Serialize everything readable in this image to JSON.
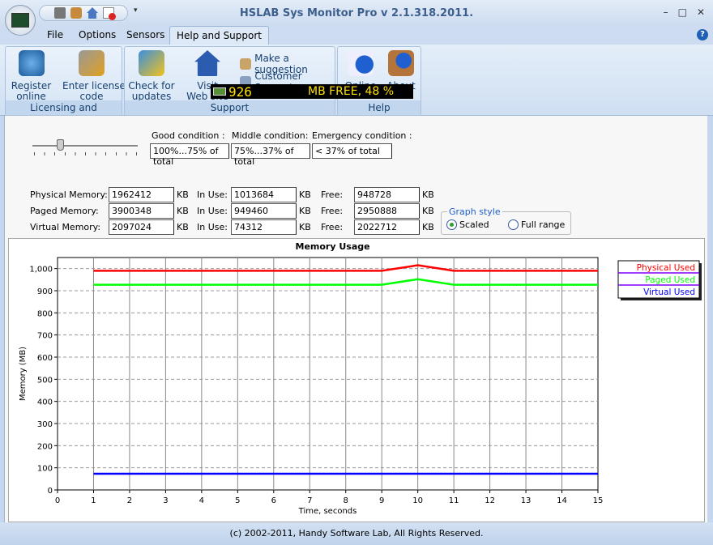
{
  "window": {
    "title": "HSLAB Sys Monitor Pro v 2.1.318.2011.",
    "controls": [
      "–",
      "□",
      "✕"
    ]
  },
  "menu_tabs": [
    {
      "label": "File"
    },
    {
      "label": "Options"
    },
    {
      "label": "Sensors"
    },
    {
      "label": "Help and Support",
      "active": true
    }
  ],
  "ribbon": {
    "groups": [
      {
        "label": "Licensing and Activation",
        "buttons": [
          {
            "label": "Register\nonline",
            "icon": "globe-checklist-icon"
          },
          {
            "label": "Enter license\ncode",
            "icon": "keys-icon"
          }
        ]
      },
      {
        "label": "Support",
        "buttons": [
          {
            "label": "Check for\nupdates",
            "icon": "refresh-arrows-icon"
          },
          {
            "label": "Visit\nWeb site",
            "icon": "house-icon"
          }
        ],
        "small_buttons": [
          {
            "label": "Make a suggestion",
            "icon": "quill-icon"
          },
          {
            "label": "Customer Support",
            "icon": "support-person-icon"
          }
        ]
      },
      {
        "label": "Help",
        "buttons": [
          {
            "label": "Online",
            "icon": "help-document-icon"
          },
          {
            "label": "About",
            "icon": "about-hand-icon"
          }
        ]
      }
    ]
  },
  "overlay": {
    "value": "926",
    "text": "MB FREE,  48 %",
    "color": "#ffe000"
  },
  "conditions": {
    "good": {
      "label": "Good condition :",
      "value": "100%...75% of total"
    },
    "middle": {
      "label": "Middle condition:",
      "value": "75%...37% of total"
    },
    "emergency": {
      "label": "Emergency condition :",
      "value": "< 37% of total"
    }
  },
  "memory": {
    "unit": "KB",
    "in_use_label": "In Use:",
    "free_label": "Free:",
    "rows": [
      {
        "label": "Physical Memory:",
        "total": "1962412",
        "in_use": "1013684",
        "free": "948728"
      },
      {
        "label": "Paged Memory:",
        "total": "3900348",
        "in_use": "949460",
        "free": "2950888"
      },
      {
        "label": "Virtual Memory:",
        "total": "2097024",
        "in_use": "74312",
        "free": "2022712"
      }
    ]
  },
  "graph_style": {
    "title": "Graph style",
    "options": [
      {
        "label": "Scaled",
        "selected": true
      },
      {
        "label": "Full range",
        "selected": false
      }
    ]
  },
  "chart_data": {
    "type": "line",
    "title": "Memory Usage",
    "xlabel": "Time, seconds",
    "ylabel": "Memory (MB)",
    "xlim": [
      0,
      15
    ],
    "ylim": [
      0,
      1050
    ],
    "xticks": [
      "0",
      "1",
      "2",
      "3",
      "4",
      "5",
      "6",
      "7",
      "8",
      "9",
      "10",
      "11",
      "12",
      "13",
      "14",
      "15"
    ],
    "yticks": [
      "0",
      "100",
      "200",
      "300",
      "400",
      "500",
      "600",
      "700",
      "800",
      "900",
      "1,000"
    ],
    "grid": true,
    "legend_position": "right",
    "x": [
      1,
      2,
      3,
      4,
      5,
      6,
      7,
      8,
      9,
      10,
      11,
      12,
      13,
      14,
      15
    ],
    "series": [
      {
        "name": "Physical Used",
        "color": "#ff0000",
        "values": [
          990,
          990,
          990,
          990,
          990,
          990,
          990,
          990,
          990,
          1015,
          990,
          990,
          990,
          990,
          990
        ]
      },
      {
        "name": "Paged Used",
        "color": "#00ff00",
        "values": [
          927,
          927,
          927,
          927,
          927,
          927,
          927,
          927,
          927,
          952,
          927,
          927,
          927,
          927,
          927
        ]
      },
      {
        "name": "Virtual Used",
        "color": "#0000ff",
        "values": [
          73,
          73,
          73,
          73,
          73,
          73,
          73,
          73,
          73,
          73,
          73,
          73,
          73,
          73,
          73
        ]
      }
    ]
  },
  "status": {
    "text": "(c) 2002-2011, Handy Software Lab, All Rights Reserved."
  }
}
